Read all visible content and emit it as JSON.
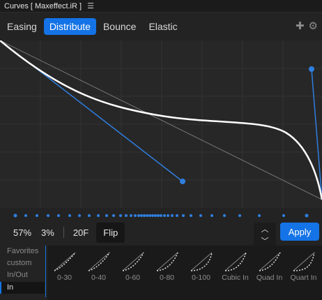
{
  "window": {
    "title": "Curves [ Maxeffect.iR ]",
    "menu_icon": "hamburger-icon"
  },
  "tabs": [
    {
      "label": "Easing",
      "active": false
    },
    {
      "label": "Distribute",
      "active": true
    },
    {
      "label": "Bounce",
      "active": false
    },
    {
      "label": "Elastic",
      "active": false
    }
  ],
  "tab_icons": [
    "plus-icon",
    "gear-icon"
  ],
  "controls": {
    "value1": "57%",
    "value2": "3%",
    "frames": "20F",
    "flip_label": "Flip",
    "apply_label": "Apply"
  },
  "categories": [
    {
      "label": "Favorites"
    },
    {
      "label": "custom"
    },
    {
      "label": "In/Out"
    },
    {
      "label": "In",
      "selected": true
    }
  ],
  "presets": [
    {
      "label": "0-30"
    },
    {
      "label": "0-40"
    },
    {
      "label": "0-60"
    },
    {
      "label": "0-80"
    },
    {
      "label": "0-100"
    },
    {
      "label": "Cubic In"
    },
    {
      "label": "Quad In"
    },
    {
      "label": "Quart In"
    }
  ],
  "colors": {
    "accent": "#1473e6",
    "curve": "#ffffff",
    "handle": "#2f7fe0",
    "grid": "#333333"
  }
}
